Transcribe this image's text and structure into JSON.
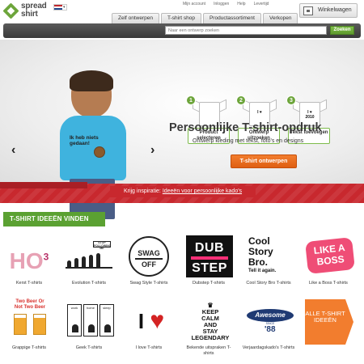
{
  "header": {
    "logo_line1": "spread",
    "logo_line2": "shirt",
    "language": "NL",
    "top_links": [
      "Mijn account",
      "Inloggen",
      "Help",
      "Levertijd"
    ],
    "nav_tabs": [
      "Zelf ontwerpen",
      "T-shirt shop",
      "Productassortiment",
      "Verkopen"
    ],
    "cart_label": "Winkelwagen"
  },
  "search": {
    "placeholder": "Naar een ontwerp zoeken",
    "button": "Zoeken"
  },
  "hero": {
    "tshirt_print": "Ik heb niets gedaan!",
    "steps": [
      {
        "num": "1",
        "label": "Product selecteren",
        "print": ""
      },
      {
        "num": "2",
        "label": "Ontwerp uitzoeken",
        "print": "I ♥"
      },
      {
        "num": "3",
        "label": "Tekst toevoegen",
        "print": "I ♥ 2010"
      }
    ],
    "title": "Persoonlijke T-shirt-opdruk",
    "subtitle": "Ontwerp kleding met tekst, foto's en designs",
    "cta": "T-shirt ontwerpen",
    "inspire_prefix": "Krijg inspiratie:",
    "inspire_link": "Ideeën voor persoonlijke kado's"
  },
  "ideas": {
    "heading": "T-SHIRT IDEEËN VINDEN",
    "tiles": [
      {
        "caption": "Kerst T-shirts",
        "art": "HO³"
      },
      {
        "caption": "Evolution T-shirts",
        "art": "STOP FOLLOWING ME"
      },
      {
        "caption": "Swag Style T-shirts",
        "art_l1": "SWAG",
        "art_l2": "OFF"
      },
      {
        "caption": "Dubstep T-shirts",
        "art_l1": "DUB",
        "art_l2": "STEP"
      },
      {
        "caption": "Cool Story Bro T-shirts",
        "art_l1": "Cool",
        "art_l2": "Story",
        "art_l3": "Bro.",
        "art_l4": "Tell it again."
      },
      {
        "caption": "Like a Boss T-shirts",
        "art": "LIKE A BOSS"
      },
      {
        "caption": "Grappige T-shirts",
        "art_l1": "Two Beer Or",
        "art_l2": "Not Two Beer"
      },
      {
        "caption": "Geek T-shirts",
        "art_l1": "work",
        "art_l2": "home",
        "art_l3": "sleep"
      },
      {
        "caption": "I love T-shirts",
        "art": "I"
      },
      {
        "caption": "Bekende uitspraken T-shirts",
        "art_l1": "KEEP",
        "art_l2": "CALM",
        "art_l3": "AND",
        "art_l4": "STAY",
        "art_l5": "LEGENDARY"
      },
      {
        "caption": "Verjaardagskado's T-shirts",
        "art_l1": "Awesome",
        "art_l2": "SINCE",
        "art_l3": "'88"
      },
      {
        "caption": "ALLE T-SHIRT IDEEËN",
        "art": ""
      }
    ]
  },
  "colors": {
    "brand_green": "#5ba132",
    "cta_orange": "#f27d2e",
    "band_red": "#c8282e"
  }
}
